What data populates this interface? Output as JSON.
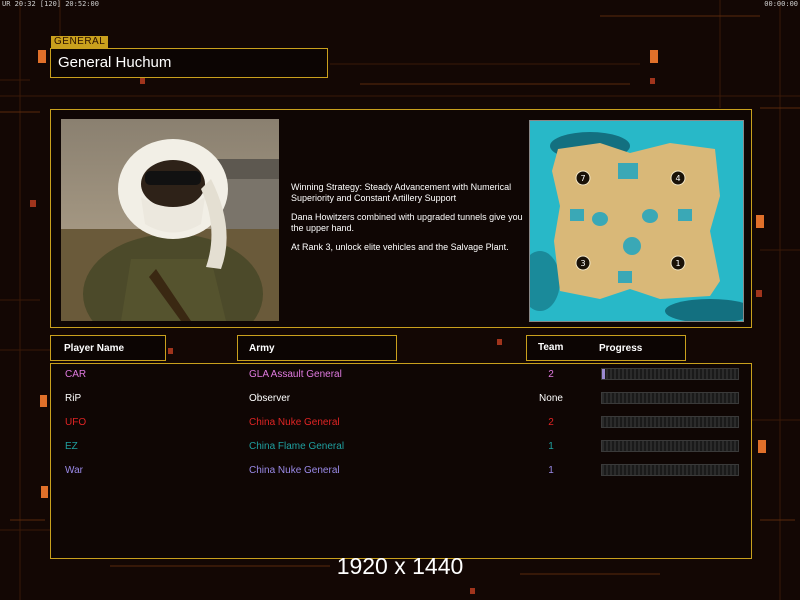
{
  "status_bar": {
    "left": "UR 20:32 [120] 20:52:00",
    "right": "00:00:00"
  },
  "general": {
    "tag": "GENERAL",
    "name": "General Huchum",
    "strategy": [
      "Winning Strategy: Steady Advancement with Numerical Superiority and Constant Artillery Support",
      "Dana Howitzers combined with upgraded tunnels give you the upper hand.",
      "At Rank 3, unlock elite vehicles and the Salvage Plant."
    ]
  },
  "map": {
    "start_positions": [
      "7",
      "4",
      "3",
      "1"
    ]
  },
  "table": {
    "headers": {
      "player": "Player Name",
      "army": "Army",
      "team": "Team",
      "progress": "Progress"
    },
    "rows": [
      {
        "name": "CAR",
        "army": "GLA Assault General",
        "team": "2",
        "color": "#e07ae0",
        "progress": 0.02
      },
      {
        "name": "RiP",
        "army": "Observer",
        "team": "None",
        "color": "#ffffff",
        "progress": 0
      },
      {
        "name": "UFO",
        "army": "China Nuke General",
        "team": "2",
        "color": "#e02424",
        "progress": 0
      },
      {
        "name": "EZ",
        "army": "China Flame General",
        "team": "1",
        "color": "#1fa0a0",
        "progress": 0
      },
      {
        "name": "War",
        "army": "China Nuke General",
        "team": "1",
        "color": "#9a8ae8",
        "progress": 0
      }
    ]
  },
  "resolution_label": "1920 x 1440",
  "colors": {
    "accent": "#c9a01d",
    "background": "#130704"
  }
}
